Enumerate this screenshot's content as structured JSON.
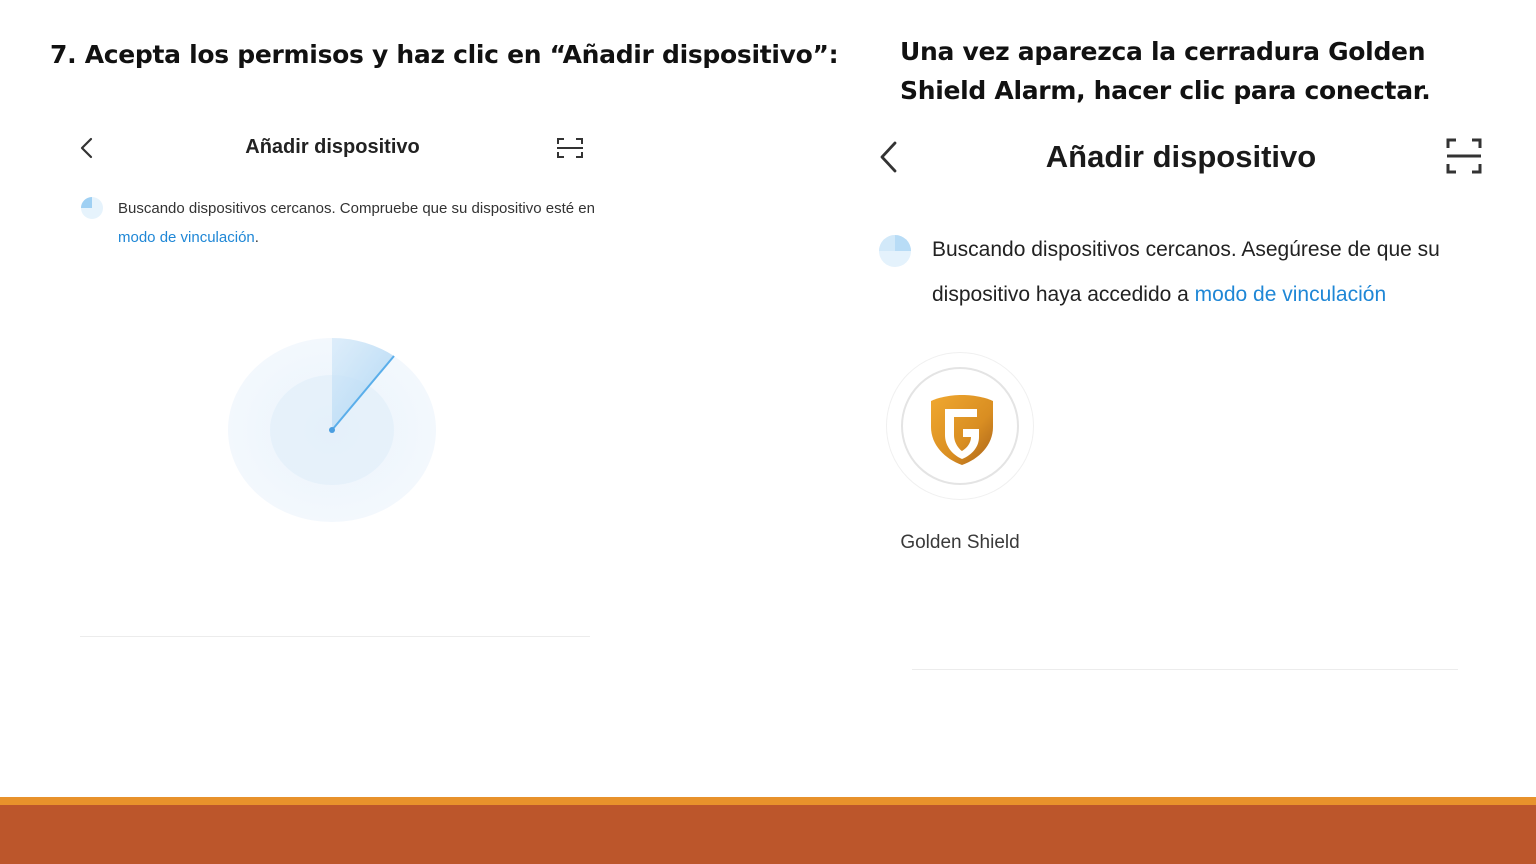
{
  "slide": {
    "step_heading": "7. Acepta los permisos y haz clic en “Añadir dispositivo”:",
    "side_heading": "Una vez aparezca la cerradura Golden Shield Alarm, hacer clic para conectar."
  },
  "left_screen": {
    "title": "Añadir dispositivo",
    "message_prefix": "Buscando dispositivos cercanos. Compruebe que su dispositivo esté en ",
    "message_link": "modo de vinculación",
    "message_suffix": ".",
    "icons": {
      "back": "chevron-left-icon",
      "scan": "scan-icon",
      "status": "loading-spinner-icon",
      "radar": "radar-scan-icon"
    }
  },
  "right_screen": {
    "title": "Añadir dispositivo",
    "message_prefix": "Buscando dispositivos cercanos. Asegúrese de que su dispositivo haya accedido a ",
    "message_link": "modo de vinculación",
    "device": {
      "name": "Golden Shield",
      "logo_letter": "G"
    },
    "icons": {
      "back": "chevron-left-icon",
      "scan": "scan-icon",
      "status": "loading-spinner-icon",
      "device_logo": "golden-shield-logo-icon"
    }
  },
  "colors": {
    "link": "#1f87d6",
    "accent_bar": "#e8922b",
    "footer_bar": "#bc562b",
    "radar_blue": "#5aaeea",
    "shield_gold": "#d98e22"
  }
}
